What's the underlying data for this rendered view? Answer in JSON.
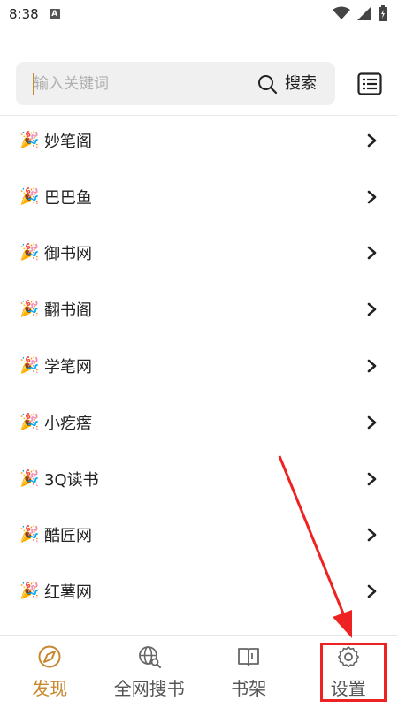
{
  "status_bar": {
    "time": "8:38",
    "notif_letter": "A"
  },
  "search": {
    "placeholder": "输入关键词",
    "value": "",
    "button_label": "搜索"
  },
  "sources": [
    {
      "label": "妙笔阁"
    },
    {
      "label": "巴巴鱼"
    },
    {
      "label": "御书网"
    },
    {
      "label": "翻书阁"
    },
    {
      "label": "学笔网"
    },
    {
      "label": "小疙瘩"
    },
    {
      "label": "3Q读书"
    },
    {
      "label": "酷匠网"
    },
    {
      "label": "红薯网"
    }
  ],
  "item_icon": "party-popper-icon",
  "bottom_nav": {
    "items": [
      {
        "label": "发现",
        "icon": "compass-icon",
        "active": true
      },
      {
        "label": "全网搜书",
        "icon": "globe-search-icon",
        "active": false
      },
      {
        "label": "书架",
        "icon": "book-icon",
        "active": false
      },
      {
        "label": "设置",
        "icon": "gear-icon",
        "active": false
      }
    ]
  },
  "colors": {
    "accent": "#c8882f",
    "annotation": "#ee2222"
  }
}
